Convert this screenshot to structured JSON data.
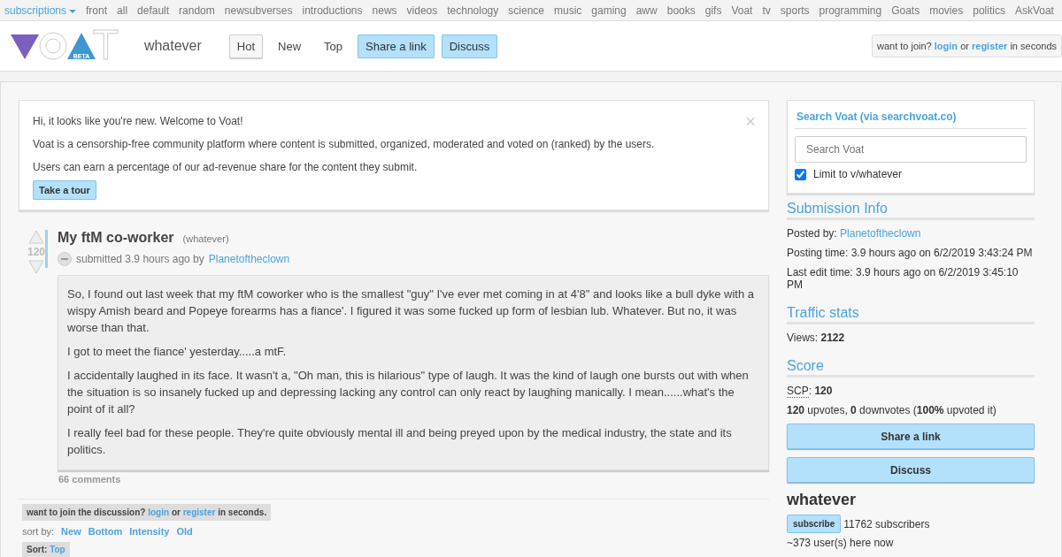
{
  "top_nav": {
    "subscriptions": "subscriptions",
    "links": [
      "front",
      "all",
      "default",
      "random",
      "newsubverses",
      "introductions",
      "news",
      "videos",
      "technology",
      "science",
      "music",
      "gaming",
      "aww",
      "books",
      "gifs",
      "Voat",
      "tv",
      "sports",
      "programming",
      "Goats",
      "movies",
      "politics",
      "AskVoat"
    ]
  },
  "header": {
    "logo": {
      "badge": "BETA",
      "end_letter": "T"
    },
    "subverse": "whatever",
    "tabs": [
      {
        "label": "Hot",
        "selected": true
      },
      {
        "label": "New",
        "selected": false
      },
      {
        "label": "Top",
        "selected": false
      }
    ],
    "actions": [
      "Share a link",
      "Discuss"
    ],
    "join": {
      "before": "want to join?",
      "login": "login",
      "middle": "or",
      "register": "register",
      "after": "in seconds"
    }
  },
  "welcome": {
    "lines": [
      "Hi, it looks like you're new. Welcome to Voat!",
      "Voat is a censorship-free community platform where content is submitted, organized, moderated and voted on (ranked) by the users.",
      "Users can earn a percentage of our ad-revenue share for the content they submit."
    ],
    "close": "×",
    "tour": "Take a tour"
  },
  "post": {
    "score": "120",
    "title": "My ftM co-worker",
    "subverse": "(whatever)",
    "submitted": "submitted 3.9 hours ago by",
    "author": "Planetoftheclown",
    "paragraphs": [
      "So, I found out last week that my ftM coworker who is the smallest \"guy\" I've ever met coming in at 4'8\" and looks like a bull dyke with a wispy Amish beard and Popeye forearms has a fiance'. I figured it was some fucked up form of lesbian lub. Whatever. But no, it was worse than that.",
      "I got to meet the fiance' yesterday.....a mtF.",
      "I accidentally laughed in its face. It wasn't a, \"Oh man, this is hilarious\" type of laugh. It was the kind of laugh one bursts out with when the situation is so insanely fucked up and depressing lacking any control can only react by laughing manically. I mean......what's the point of it all?",
      "I really feel bad for these people. They're quite obviously mental ill and being preyed upon by the medical industry, the state and its politics."
    ],
    "comments": "66 comments"
  },
  "discussion": {
    "join": {
      "before": "want to join the discussion?",
      "login": "login",
      "middle": "or",
      "register": "register",
      "after": "in seconds."
    },
    "sort_label": "sort by:",
    "sort_options": [
      "New",
      "Bottom",
      "Intensity",
      "Old"
    ],
    "current_sort": {
      "label": "Sort:",
      "value": "Top"
    }
  },
  "sidebar": {
    "search": {
      "title": "Search Voat (via searchvoat.co)",
      "placeholder": "Search Voat",
      "limit": {
        "label": "Limit to v/whatever",
        "checked": true
      }
    },
    "submission_info": {
      "heading": "Submission Info",
      "posted_by_label": "Posted by:",
      "posted_by": "Planetoftheclown",
      "posting_time": "Posting time: 3.9 hours ago on 6/2/2019 3:43:24 PM",
      "last_edit": "Last edit time: 3.9 hours ago on 6/2/2019 3:45:10 PM"
    },
    "traffic": {
      "heading": "Traffic stats",
      "views_label": "Views:",
      "views": "2122"
    },
    "score": {
      "heading": "Score",
      "scp_label": "SCP",
      "scp_sep": ":",
      "scp": "120",
      "votes": "**120** upvotes, **0** downvotes (**100%** upvoted it)"
    },
    "buttons": [
      "Share a link",
      "Discuss"
    ],
    "subverse": {
      "name": "whatever",
      "subscribe": "subscribe",
      "subscribers": "11762 subscribers",
      "online": "~373 user(s) here now"
    }
  }
}
